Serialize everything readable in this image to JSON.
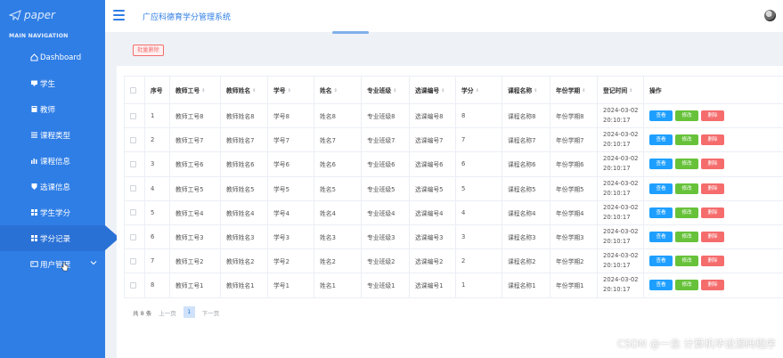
{
  "app": {
    "logo_text": "paper",
    "system_title": "广应科德育学分管理系统"
  },
  "sidebar": {
    "heading": "MAIN NAVIGATION",
    "items": [
      {
        "label": "Dashboard",
        "icon": "home-icon"
      },
      {
        "label": "学生",
        "icon": "monitor-icon"
      },
      {
        "label": "教师",
        "icon": "book-icon"
      },
      {
        "label": "课程类型",
        "icon": "list-icon"
      },
      {
        "label": "课程信息",
        "icon": "bar-chart-icon"
      },
      {
        "label": "选课信息",
        "icon": "shield-icon"
      },
      {
        "label": "学生学分",
        "icon": "grid-icon"
      },
      {
        "label": "学分记录",
        "icon": "grid-icon",
        "active": true
      },
      {
        "label": "用户管理",
        "icon": "id-card-icon",
        "expandable": true
      }
    ]
  },
  "toolbar": {
    "batch_delete_label": "批量删除"
  },
  "table": {
    "headers": [
      "序号",
      "教师工号",
      "教师姓名",
      "学号",
      "姓名",
      "专业班级",
      "选课编号",
      "学分",
      "课程名称",
      "年份学期",
      "登记时间",
      "操作"
    ],
    "rows": [
      {
        "no": "1",
        "teacher_id": "教师工号8",
        "teacher_name": "教师姓名8",
        "student_id": "学号8",
        "name": "姓名8",
        "class": "专业班级8",
        "course_no": "选课编号8",
        "credit": "8",
        "course_name": "课程名称8",
        "term": "年份学期8",
        "date": "2024-03-02",
        "time": "20:10:17"
      },
      {
        "no": "2",
        "teacher_id": "教师工号7",
        "teacher_name": "教师姓名7",
        "student_id": "学号7",
        "name": "姓名7",
        "class": "专业班级7",
        "course_no": "选课编号7",
        "credit": "7",
        "course_name": "课程名称7",
        "term": "年份学期7",
        "date": "2024-03-02",
        "time": "20:10:17"
      },
      {
        "no": "3",
        "teacher_id": "教师工号6",
        "teacher_name": "教师姓名6",
        "student_id": "学号6",
        "name": "姓名6",
        "class": "专业班级6",
        "course_no": "选课编号6",
        "credit": "6",
        "course_name": "课程名称6",
        "term": "年份学期6",
        "date": "2024-03-02",
        "time": "20:10:17"
      },
      {
        "no": "4",
        "teacher_id": "教师工号5",
        "teacher_name": "教师姓名5",
        "student_id": "学号5",
        "name": "姓名5",
        "class": "专业班级5",
        "course_no": "选课编号5",
        "credit": "5",
        "course_name": "课程名称5",
        "term": "年份学期5",
        "date": "2024-03-02",
        "time": "20:10:17"
      },
      {
        "no": "5",
        "teacher_id": "教师工号4",
        "teacher_name": "教师姓名4",
        "student_id": "学号4",
        "name": "姓名4",
        "class": "专业班级4",
        "course_no": "选课编号4",
        "credit": "4",
        "course_name": "课程名称4",
        "term": "年份学期4",
        "date": "2024-03-02",
        "time": "20:10:17"
      },
      {
        "no": "6",
        "teacher_id": "教师工号3",
        "teacher_name": "教师姓名3",
        "student_id": "学号3",
        "name": "姓名3",
        "class": "专业班级3",
        "course_no": "选课编号3",
        "credit": "3",
        "course_name": "课程名称3",
        "term": "年份学期3",
        "date": "2024-03-02",
        "time": "20:10:17"
      },
      {
        "no": "7",
        "teacher_id": "教师工号2",
        "teacher_name": "教师姓名2",
        "student_id": "学号2",
        "name": "姓名2",
        "class": "专业班级2",
        "course_no": "选课编号2",
        "credit": "2",
        "course_name": "课程名称2",
        "term": "年份学期2",
        "date": "2024-03-02",
        "time": "20:10:17"
      },
      {
        "no": "8",
        "teacher_id": "教师工号1",
        "teacher_name": "教师姓名1",
        "student_id": "学号1",
        "name": "姓名1",
        "class": "专业班级1",
        "course_no": "选课编号1",
        "credit": "1",
        "course_name": "课程名称1",
        "term": "年份学期1",
        "date": "2024-03-02",
        "time": "20:10:17"
      }
    ],
    "actions": {
      "view": "查看",
      "edit": "修改",
      "delete": "删除"
    }
  },
  "pagination": {
    "total": "共 8 条",
    "prev": "上一页",
    "current": "1",
    "next": "下一页"
  },
  "watermark": "CSDN @一念 计算机毕设源码程序",
  "colors": {
    "sidebar": "#2f7ee6",
    "view_button": "#1e9fff",
    "edit_button": "#67c23a",
    "delete_button": "#f56c6c"
  }
}
